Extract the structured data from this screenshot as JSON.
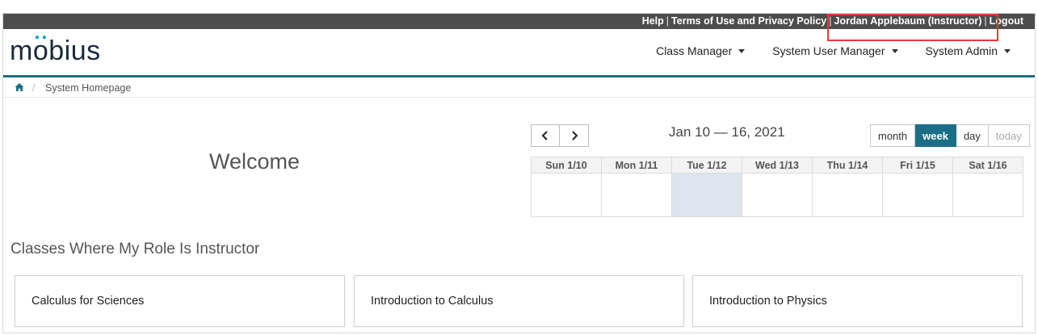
{
  "topbar": {
    "help": "Help",
    "terms": "Terms of Use and Privacy Policy",
    "user": "Jordan Applebaum (Instructor)",
    "logout": "Logout",
    "separator": "|"
  },
  "logo": {
    "text_m": "m",
    "text_o": "o",
    "text_rest": "bius"
  },
  "nav": {
    "items": [
      {
        "label": "Class Manager"
      },
      {
        "label": "System User Manager"
      },
      {
        "label": "System Admin"
      }
    ]
  },
  "breadcrumb": {
    "separator": "/",
    "page": "System Homepage"
  },
  "welcome": "Welcome",
  "calendar": {
    "prev": "<",
    "next": ">",
    "title": "Jan 10 — 16, 2021",
    "views": {
      "month": "month",
      "week": "week",
      "day": "day",
      "today": "today"
    },
    "active_view": "week",
    "days": [
      "Sun 1/10",
      "Mon 1/11",
      "Tue 1/12",
      "Wed 1/13",
      "Thu 1/14",
      "Fri 1/15",
      "Sat 1/16"
    ],
    "highlight_day_index": 2
  },
  "section": {
    "title": "Classes Where My Role Is Instructor"
  },
  "classes": [
    {
      "name": "Calculus for Sciences"
    },
    {
      "name": "Introduction to Calculus"
    },
    {
      "name": "Introduction to Physics"
    }
  ],
  "colors": {
    "accent": "#1a6f86",
    "topbar": "#4d4d4d",
    "highlight_box": "#e53b3b",
    "today_col": "#dde5ee"
  }
}
